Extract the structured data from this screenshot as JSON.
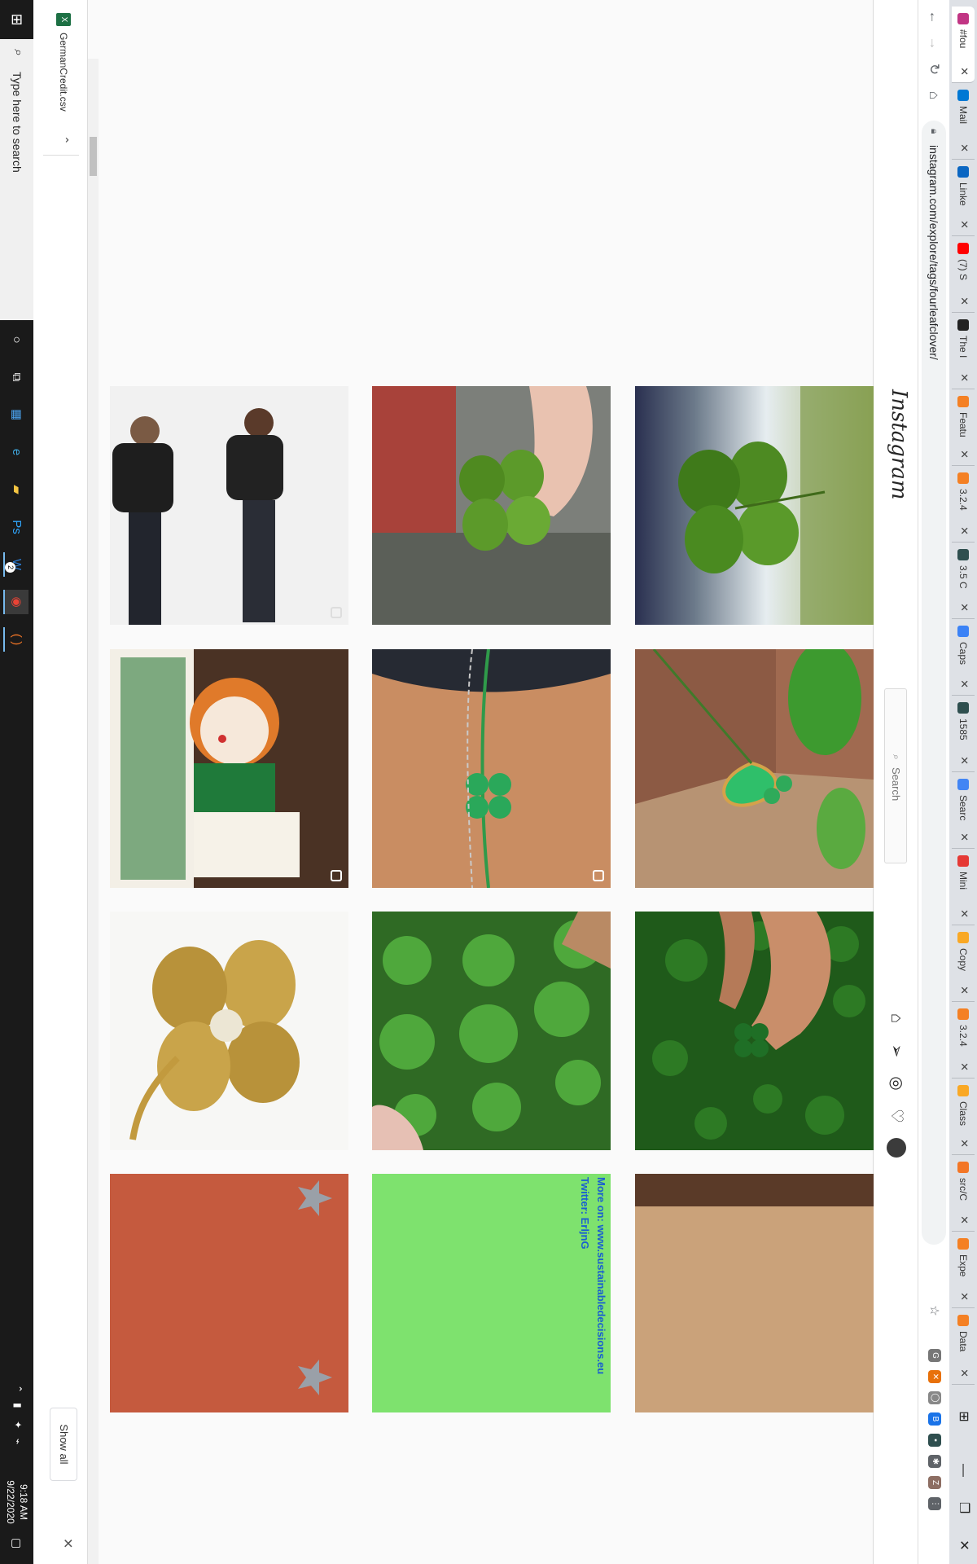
{
  "browser": {
    "tabs": [
      {
        "title": "#fou",
        "color": "#c13584",
        "active": true
      },
      {
        "title": "Mail",
        "color": "#0078d4"
      },
      {
        "title": "Linke",
        "color": "#0a66c2"
      },
      {
        "title": "(7) S",
        "color": "#ff0000"
      },
      {
        "title": "The I",
        "color": "#222222"
      },
      {
        "title": "Featu",
        "color": "#f48024"
      },
      {
        "title": "3.2.4",
        "color": "#f48024"
      },
      {
        "title": "3.5 C",
        "color": "#2f4f4f"
      },
      {
        "title": "Caps",
        "color": "#3b82f6"
      },
      {
        "title": "1585",
        "color": "#2f4f4f"
      },
      {
        "title": "Searc",
        "color": "#4285f4"
      },
      {
        "title": "Mini",
        "color": "#e53935"
      },
      {
        "title": "Copy",
        "color": "#f9a825"
      },
      {
        "title": "3.2.4",
        "color": "#f48024"
      },
      {
        "title": "Class",
        "color": "#f9a825"
      },
      {
        "title": "src/C",
        "color": "#f37626"
      },
      {
        "title": "Expe",
        "color": "#f48024"
      },
      {
        "title": "Data",
        "color": "#f48024"
      }
    ],
    "url": "instagram.com/explore/tags/fourleafclover/",
    "extensions": [
      {
        "name": "google-icon",
        "glyph": "G",
        "color": "#777777"
      },
      {
        "name": "extension-x-icon",
        "glyph": "✕",
        "color": "#e8710a"
      },
      {
        "name": "circle-extension-icon",
        "glyph": "◯",
        "color": "#888888"
      },
      {
        "name": "b-extension-icon",
        "glyph": "B",
        "color": "#1a73e8"
      },
      {
        "name": "analytics-extension-icon",
        "glyph": "▪",
        "color": "#2f4f4f"
      },
      {
        "name": "puzzle-icon",
        "glyph": "✱",
        "color": "#5f6368"
      },
      {
        "name": "profile-avatar-icon",
        "glyph": "Z",
        "color": "#8d6e63"
      },
      {
        "name": "menu-dots-icon",
        "glyph": "⋮",
        "color": "#5f6368"
      }
    ]
  },
  "instagram": {
    "logo": "Instagram",
    "search_placeholder": "Search",
    "nav_icons": [
      "home-icon",
      "direct-message-icon",
      "explore-icon",
      "activity-heart-icon",
      "profile-avatar"
    ]
  },
  "posts": [
    {
      "name": "post-clover-sky"
    },
    {
      "name": "post-clover-necklace"
    },
    {
      "name": "post-clover-hand-grass"
    },
    {
      "name": "post-partial-hair"
    },
    {
      "name": "post-clover-fingers"
    },
    {
      "name": "post-clover-bracelet",
      "multi": true
    },
    {
      "name": "post-clover-patch"
    },
    {
      "name": "post-text-banner",
      "text1": "More on: www.sustainabledecisions.eu",
      "text2": "Twitter: ErljnG"
    },
    {
      "name": "post-tshirt-models",
      "multi": true
    },
    {
      "name": "post-leprechaun-doll",
      "multi": true
    },
    {
      "name": "post-gold-clover-brooch"
    },
    {
      "name": "post-partial-stars"
    }
  ],
  "downloads": {
    "file_name": "GermanCredit.csv",
    "show_all": "Show all"
  },
  "taskbar": {
    "search_placeholder": "Type here to search",
    "badge_count": "2",
    "time": "9:18 AM",
    "date": "9/22/2020"
  }
}
